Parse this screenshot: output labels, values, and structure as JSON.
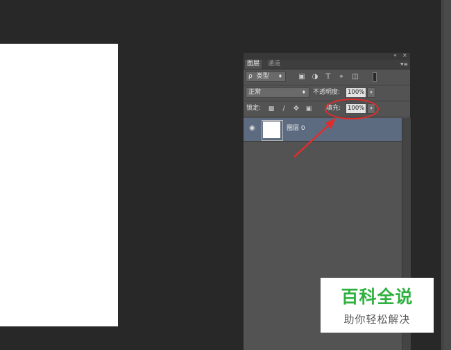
{
  "panel": {
    "top_controls": {
      "collapse_icon": "double-chevron-left-icon",
      "collapse_glyph": "«",
      "close_icon": "close-icon",
      "close_glyph": "×",
      "menu_icon": "panel-menu-icon",
      "menu_glyph": "▾≡"
    },
    "tabs": [
      {
        "label": "图层",
        "active": true
      },
      {
        "label": "通道",
        "active": false
      }
    ],
    "filter": {
      "search_glyph": "ρ",
      "label": "类型",
      "arrow": "♦",
      "icons": [
        "image-filter-icon",
        "adjustment-filter-icon",
        "type-filter-icon",
        "shape-filter-icon",
        "smart-object-filter-icon",
        "filter-toggle-icon"
      ]
    },
    "blend": {
      "mode": "正常",
      "arrow": "♦",
      "opacity_label": "不透明度:",
      "opacity_value": "100%",
      "dropdown_glyph": "▾"
    },
    "lock": {
      "label": "锁定:",
      "icons": [
        "lock-transparent-pixels-icon",
        "lock-image-pixels-icon",
        "lock-position-icon",
        "lock-all-icon"
      ],
      "fill_label": "填充:",
      "fill_value": "100%",
      "dropdown_glyph": "▾"
    },
    "layers": [
      {
        "name": "图层 0",
        "visible_glyph": "◉"
      }
    ]
  },
  "watermark": {
    "title": "百科全说",
    "subtitle": "助你轻松解决"
  },
  "colors": {
    "annotation": "#e22c2c",
    "selected_layer": "#5c6b80",
    "watermark_green": "#2fb03f"
  }
}
